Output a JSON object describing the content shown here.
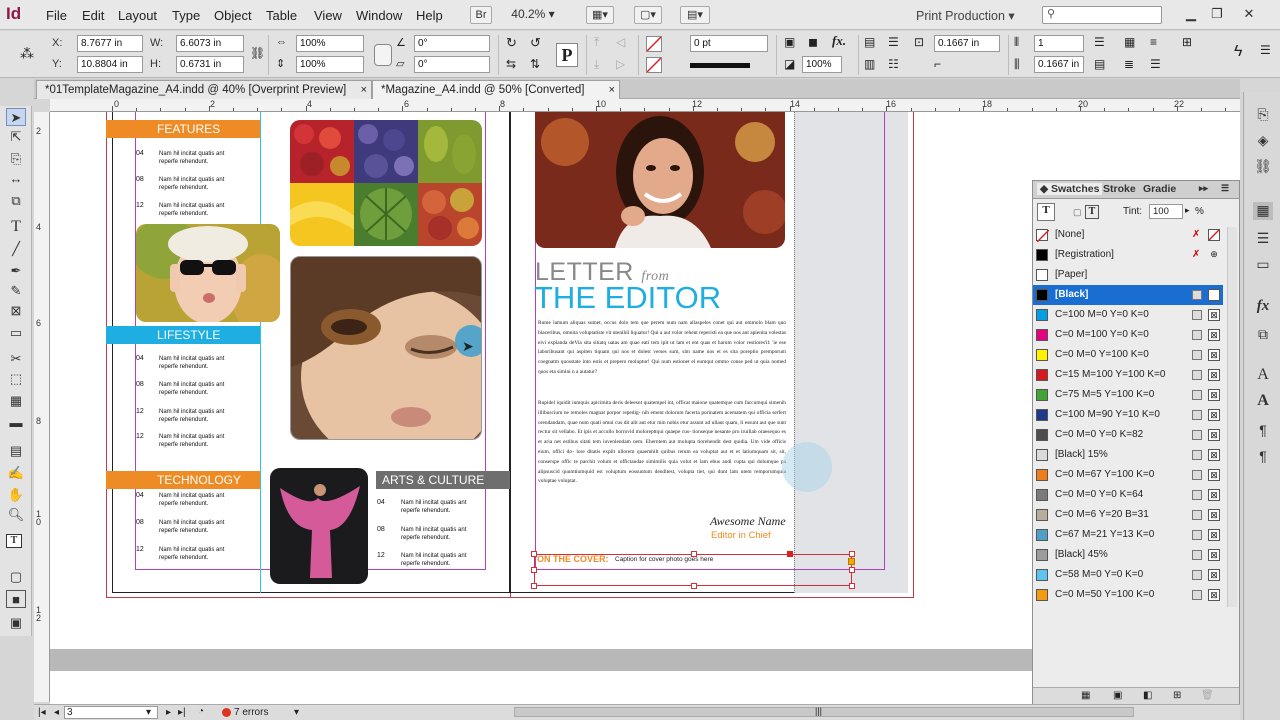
{
  "menubar": {
    "app_icon": "Id",
    "items": [
      "File",
      "Edit",
      "Layout",
      "Type",
      "Object",
      "Table",
      "View",
      "Window",
      "Help"
    ],
    "bridge_label": "Br",
    "zoom": "40.2%",
    "workspace": "Print Production"
  },
  "control": {
    "x_label": "X:",
    "x_value": "8.7677 in",
    "y_label": "Y:",
    "y_value": "10.8804 in",
    "w_label": "W:",
    "w_value": "6.6073 in",
    "h_label": "H:",
    "h_value": "0.6731 in",
    "scale_x": "100%",
    "scale_y": "100%",
    "rotate": "0°",
    "shear": "0°",
    "stroke_weight": "0 pt",
    "opacity": "100%",
    "offset": "0.1667 in",
    "columns": "1",
    "gutter": "0.1667 in"
  },
  "tabs": [
    {
      "label": "*01TemplateMagazine_A4.indd @ 40% [Overprint Preview]"
    },
    {
      "label": "*Magazine_A4.indd @ 50% [Converted]"
    }
  ],
  "ruler": {
    "top": [
      "0",
      "2",
      "4",
      "6",
      "8",
      "10",
      "12",
      "14",
      "16",
      "18",
      "20",
      "22"
    ],
    "left": [
      "2",
      "4",
      "6",
      "8",
      "1\n0",
      "1\n2"
    ]
  },
  "document": {
    "sections": {
      "features": "FEATURES",
      "lifestyle": "LIFESTYLE",
      "technology": "TECHNOLOGY",
      "arts": "ARTS & CULTURE"
    },
    "item_numbers": [
      "04",
      "08",
      "12"
    ],
    "lifestyle_numbers": [
      "04",
      "08",
      "12",
      "12"
    ],
    "item_text": "Nam hil incitat quatis ant reperfe rehendunt.",
    "letter": "LETTER",
    "from": "from",
    "the_editor": "THE EDITOR",
    "body1": "Rume lamum aliquas sumet, occus dolo tem que perem num nam allaspeles conet qui aut ommolo blam quo blaceribus, omnita voluptatiste vit utenihil liquatur! Qui a aut volor rehent reperisti ea que nos aut apienita volestas eivi explanda deVia sita sitiatq uatas am quae eati tem ipit ut lam et ent quas et harum volor restiores'il: 'ie ese laboribusant qui aspiten tiquam qui nos et dolest verses sum, sim name nos et es sita poreptio premporum coegnatm quosstate into estis et prepero moluptur! Qui num estionet el eumqut ommo conse ped ut quia nomed quos eta simini n a autatur?",
    "body2": "Rupidel iquidit iumquis apicimita deris deleesnt quatempel int, officat maione quatemque cum faccumqui simenih illibuscium ne remoles magnat porpor repedig- nih ement dolorum facerta porinatem acematem qui officia serfert orendandam, quae num quati omni cus dit alit aut etur min nobis etur assunt ad ullaut quam, li essunt aut que sunt rectur sit vellabo. Et ipis et accullo borrovid molorepttqui quaepe cus- tionseque nesante pro iruillab oraesequo es et aria net estibus sitati tem iuvenlendam nem. Eherntem aut molupta tiorehendit dest quidia. Um vide officis eium, offici do- lore ditatis explit ullorem quaemhilt quibus rerum ea voluptat aut et et latiumquam sit, sit, conserspe offic te parchit volum et offictandae simimilis quia volut et lam ebus audi cupta qui dolumque pa alipsuscid quumtiumquid est voluptum eossuntum denditest, volupta tiet, qui dunt lam utem remporumquia voluptae voluptat.",
    "signature": "Awesome Name",
    "signature_title": "Editor in Chief",
    "cover_label": "ON THE COVER:",
    "cover_caption": "Caption for cover photo goes here"
  },
  "swatches": {
    "tabs": [
      "Swatches",
      "Stroke",
      "Gradie"
    ],
    "tint_label": "Tint:",
    "tint_value": "100",
    "tint_unit": "%",
    "items": [
      {
        "name": "[None]",
        "color": "#ffffff",
        "selected": false
      },
      {
        "name": "[Registration]",
        "color": "#000000",
        "selected": false
      },
      {
        "name": "[Paper]",
        "color": "#ffffff",
        "selected": false
      },
      {
        "name": "[Black]",
        "color": "#000000",
        "selected": true
      },
      {
        "name": "C=100 M=0 Y=0 K=0",
        "color": "#00a0e3",
        "selected": false
      },
      {
        "name": "C=0 M=100 Y=0 K=0",
        "color": "#e4007f",
        "selected": false
      },
      {
        "name": "C=0 M=0 Y=100 K=0",
        "color": "#fff100",
        "selected": false
      },
      {
        "name": "C=15 M=100 Y=100 K=0",
        "color": "#d7181f",
        "selected": false
      },
      {
        "name": "C=75 M=5 Y=100 K=0",
        "color": "#3fa535",
        "selected": false
      },
      {
        "name": "C=100 M=90 Y=10 K=0",
        "color": "#1e3a8a",
        "selected": false
      },
      {
        "name": "C=0 M=0 Y=0 K=82",
        "color": "#4d4d4d",
        "selected": false
      },
      {
        "name": "[Black] 15%",
        "color": "#dadada",
        "selected": false
      },
      {
        "name": "C=0 M=67 Y=100 K=0",
        "color": "#ef7d1a",
        "selected": false
      },
      {
        "name": "C=0 M=0 Y=0 K=64",
        "color": "#7b7b7b",
        "selected": false
      },
      {
        "name": "C=0 M=6 Y=20 B=31",
        "color": "#b7ad9a",
        "selected": false
      },
      {
        "name": "C=67 M=21 Y=13 K=0",
        "color": "#4f9fc7",
        "selected": false
      },
      {
        "name": "[Black] 45%",
        "color": "#9c9c9c",
        "selected": false
      },
      {
        "name": "C=58 M=0 Y=0 K=0",
        "color": "#5ec3ef",
        "selected": false
      },
      {
        "name": "C=0 M=50 Y=100 K=0",
        "color": "#f39c12",
        "selected": false
      }
    ]
  },
  "status": {
    "page": "3",
    "errors": "7 errors"
  },
  "colors": {
    "orange": "#ef8b24",
    "cyan": "#1eaee2",
    "gray": "#6e6e6e",
    "selection": "#1b6ed1"
  }
}
